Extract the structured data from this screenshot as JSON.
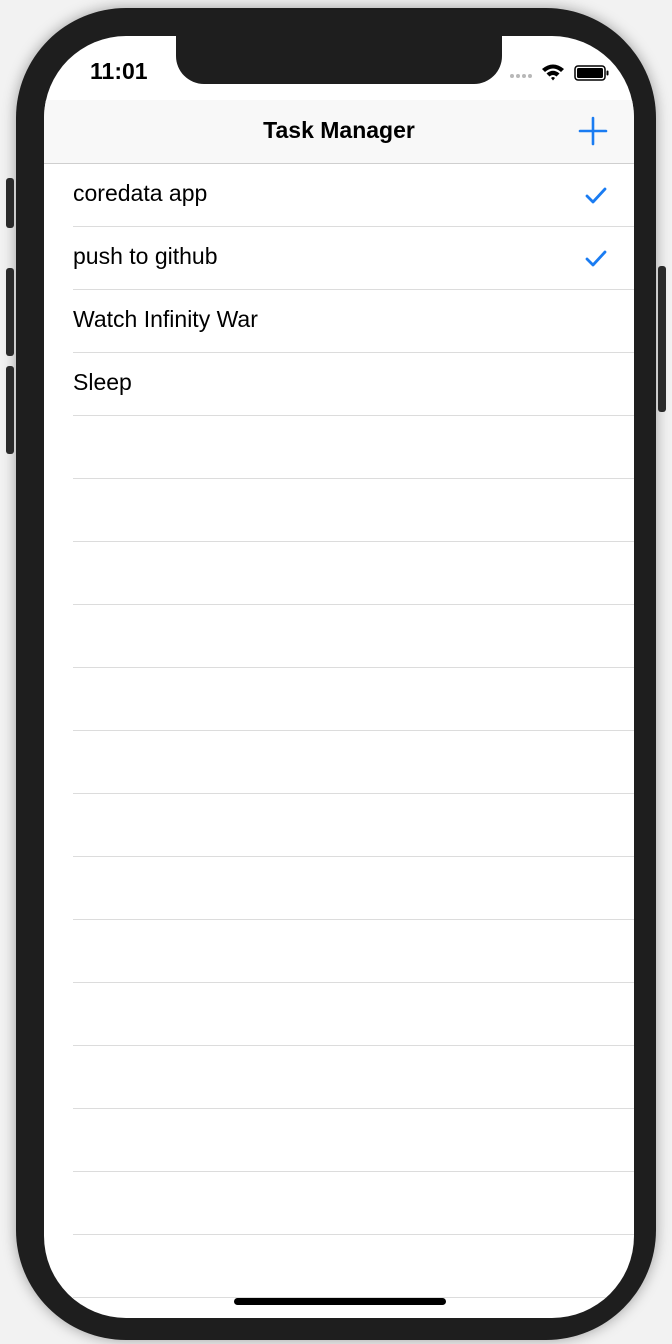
{
  "status_bar": {
    "time": "11:01"
  },
  "navbar": {
    "title": "Task Manager"
  },
  "tasks": [
    {
      "label": "coredata app",
      "done": true
    },
    {
      "label": "push to github",
      "done": true
    },
    {
      "label": "Watch Infinity War",
      "done": false
    },
    {
      "label": "Sleep",
      "done": false
    }
  ],
  "colors": {
    "tint": "#1a7cf2"
  }
}
